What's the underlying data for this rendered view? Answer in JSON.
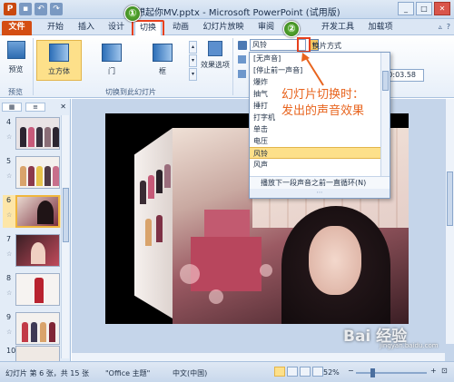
{
  "window": {
    "title": "想起你MV.pptx - Microsoft PowerPoint (试用版)"
  },
  "tabs": [
    {
      "label": "文件"
    },
    {
      "label": "开始"
    },
    {
      "label": "插入"
    },
    {
      "label": "设计"
    },
    {
      "label": "切换"
    },
    {
      "label": "动画"
    },
    {
      "label": "幻灯片放映"
    },
    {
      "label": "审阅"
    },
    {
      "label": "开发工具"
    },
    {
      "label": "加载项"
    }
  ],
  "badges": [
    "①",
    "②"
  ],
  "ribbon": {
    "preview_label": "预览",
    "preview_group": "预览",
    "transitions": [
      {
        "label": "立方体"
      },
      {
        "label": "门"
      },
      {
        "label": "框"
      }
    ],
    "effect_options_label": "效果选项",
    "transition_group": "切换到此幻灯片",
    "sound_value": "风铃",
    "advance_label": "换片方式",
    "time_value": "00:03.58"
  },
  "sound_dropdown": {
    "items": [
      {
        "label": "[无声音]"
      },
      {
        "label": "[停止前一声音]"
      },
      {
        "label": "爆炸"
      },
      {
        "label": "抽气"
      },
      {
        "label": "捶打"
      },
      {
        "label": "打字机"
      },
      {
        "label": "单击"
      },
      {
        "label": "电压"
      },
      {
        "label": "风铃",
        "selected": true
      },
      {
        "label": "风声"
      }
    ],
    "loop_label": "播放下一段声音之前一直循环(N)"
  },
  "callout": {
    "line1": "幻灯片切换时：",
    "line2": "发出的声音效果"
  },
  "slides_panel": {
    "slides": [
      {
        "num": "4",
        "star": "☆"
      },
      {
        "num": "5",
        "star": "☆"
      },
      {
        "num": "6",
        "star": "☆",
        "selected": true
      },
      {
        "num": "7",
        "star": "☆"
      },
      {
        "num": "8",
        "star": "☆"
      },
      {
        "num": "9",
        "star": "☆"
      },
      {
        "num": "10",
        "star": "☆"
      }
    ]
  },
  "status": {
    "slide_info": "幻灯片 第 6 张，共 15 张",
    "theme": "\"Office 主题\"",
    "language": "中文(中国)",
    "zoom": "52%",
    "zoom_value": 0.52
  },
  "watermark": {
    "text": "Bai 经验",
    "sub": "jingyan.baidu.com"
  },
  "colors": {
    "file_tab": "#d44d12",
    "highlight": "#e7401d",
    "callout": "#e8641e",
    "badge": "#4c9a27",
    "selected": "#fde08a"
  }
}
